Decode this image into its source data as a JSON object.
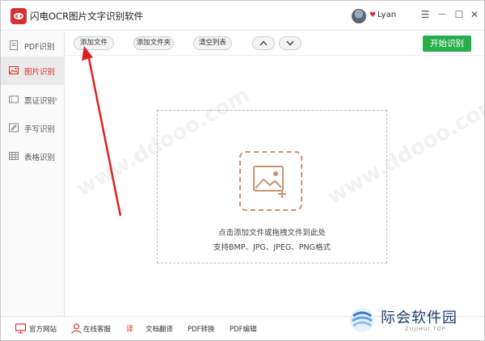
{
  "app": {
    "title": "闪电OCR图片文字识别软件",
    "username": "Lyan"
  },
  "window_controls": {
    "menu": "☰",
    "minimize": "—",
    "maximize": "☐",
    "close": "✕"
  },
  "sidebar": {
    "items": [
      {
        "label": "PDF识别",
        "icon": "pdf-icon",
        "active": false
      },
      {
        "label": "图片识别",
        "icon": "image-icon",
        "active": true
      },
      {
        "label": "票证识别",
        "icon": "ticket-icon",
        "active": false
      },
      {
        "label": "手写识别",
        "icon": "handwriting-icon",
        "active": false
      },
      {
        "label": "表格识别",
        "icon": "table-icon",
        "active": false
      }
    ]
  },
  "toolbar": {
    "add_file": "添加文件",
    "add_folder": "添加文件夹",
    "clear_list": "清空列表",
    "start": "开始识别"
  },
  "dropzone": {
    "hint": "点击添加文件或拖拽文件到此处",
    "formats": "支持BMP、JPG、JPEG、PNG格式"
  },
  "statusbar": {
    "items": [
      {
        "label": "官方网站",
        "icon": "monitor-icon"
      },
      {
        "label": "在线客服",
        "icon": "support-icon"
      },
      {
        "label": "文档翻译",
        "icon": "translate-icon"
      },
      {
        "label": "PDF转换",
        "icon": ""
      },
      {
        "label": "PDF编辑",
        "icon": ""
      }
    ]
  },
  "watermark": {
    "brand": "际会软件园",
    "sub": "ZUJIHUI.TOP"
  },
  "colors": {
    "accent": "#d8312e",
    "start_green": "#27ae4a",
    "upload_border": "#c9926e",
    "annotation_arrow": "#e02020"
  }
}
